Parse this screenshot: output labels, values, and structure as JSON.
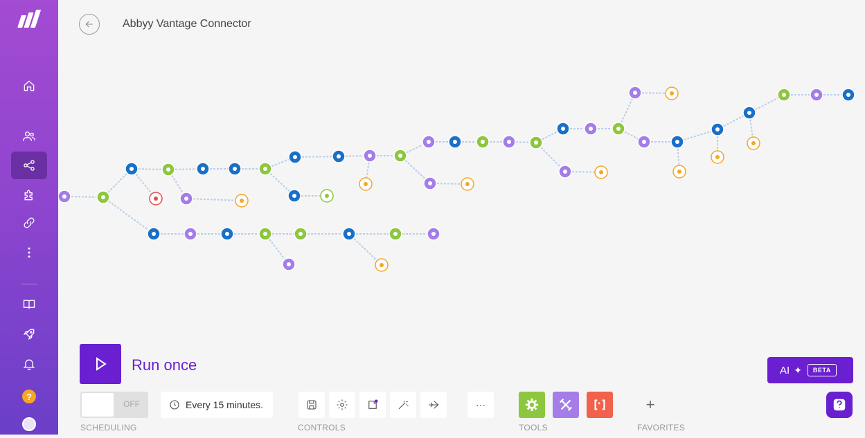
{
  "scenario": {
    "title": "Abbyy Vantage Connector"
  },
  "sidebar": {
    "items": [
      {
        "name": "home"
      },
      {
        "name": "team"
      },
      {
        "name": "scenarios"
      },
      {
        "name": "apps"
      },
      {
        "name": "connections"
      },
      {
        "name": "more"
      },
      {
        "name": "docs"
      },
      {
        "name": "whats-new"
      },
      {
        "name": "notifications"
      },
      {
        "name": "help"
      },
      {
        "name": "profile"
      }
    ],
    "help_glyph": "?"
  },
  "run": {
    "label": "Run once"
  },
  "scheduling": {
    "toggle_state": "OFF",
    "interval": "Every 15 minutes.",
    "section_label": "SCHEDULING"
  },
  "controls": {
    "section_label": "CONTROLS",
    "more_glyph": "···"
  },
  "tools": {
    "section_label": "TOOLS",
    "colors": {
      "flow_control": "#8dc63f",
      "tools": "#a47de8",
      "text_parser": "#f1614b"
    }
  },
  "favorites": {
    "section_label": "FAVORITES",
    "add_glyph": "+"
  },
  "ai": {
    "label": "AI",
    "badge": "BETA"
  },
  "colors": {
    "accent": "#6a1fd0",
    "router": "#8dc63f",
    "tools": "#a47de8",
    "http": "#1a6fc8",
    "break": "#f5a623",
    "error": "#e14d4d"
  }
}
